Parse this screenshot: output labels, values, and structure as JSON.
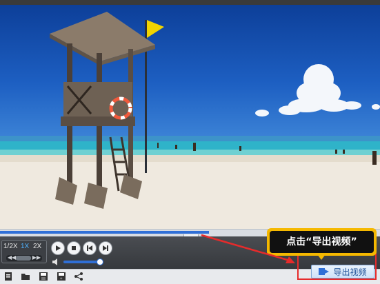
{
  "video": {
    "scene": "beach-lifeguard-tower",
    "colors": {
      "sky": "#1d5fc2",
      "sea": "#2fb3c9",
      "sand": "#efe9df"
    }
  },
  "player": {
    "progress_fraction": 0.55,
    "speed_options": [
      {
        "label": "1/2X",
        "active": false
      },
      {
        "label": "1X",
        "active": true
      },
      {
        "label": "2X",
        "active": false
      }
    ],
    "volume_fraction": 0.92,
    "controls": [
      "play-icon",
      "stop-icon",
      "previous-icon",
      "next-icon"
    ]
  },
  "toolbar": {
    "icons": [
      "document-icon",
      "open-folder-icon",
      "save-icon",
      "save-as-icon",
      "share-icon"
    ],
    "export_label": "导出视频"
  },
  "annotation": {
    "callout_text": "点击“导出视频”",
    "accent": "#f5b800",
    "highlight_color": "#e62b2b"
  }
}
